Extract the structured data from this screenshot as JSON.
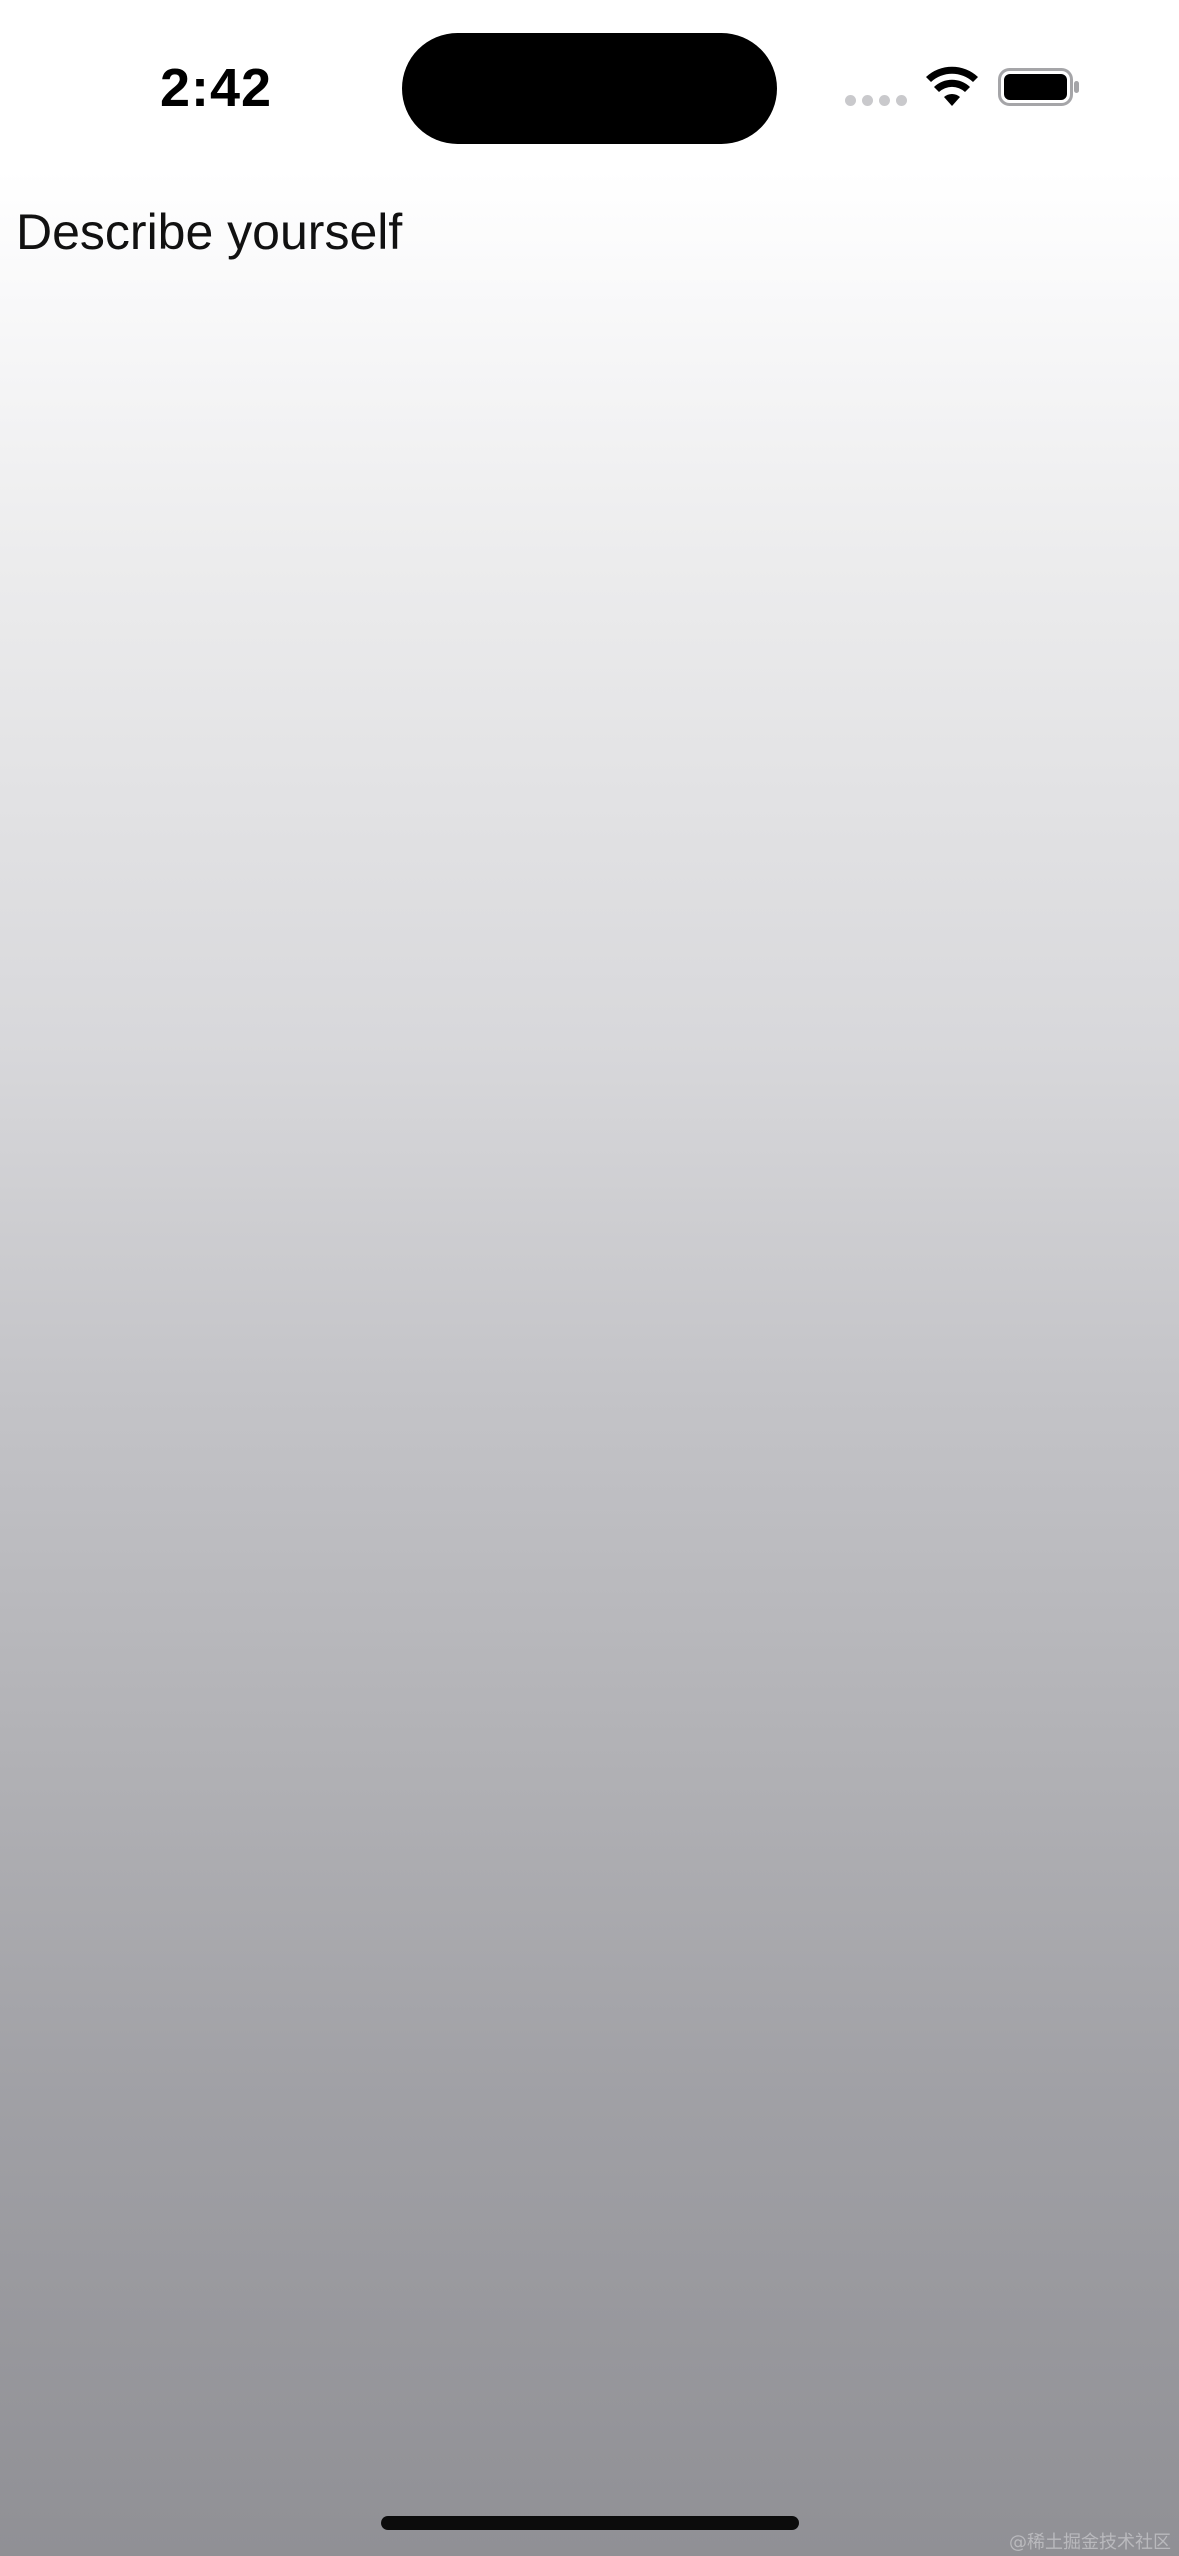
{
  "status_bar": {
    "time": "2:42",
    "icons": [
      "signal-dots-icon",
      "wifi-icon",
      "battery-icon"
    ]
  },
  "content": {
    "prompt_text": "Describe yourself"
  },
  "watermark": {
    "text": "@稀土掘金技术社区"
  },
  "colors": {
    "gradient_top": "#ffffff",
    "gradient_bottom": "#909095",
    "text": "#111111"
  }
}
